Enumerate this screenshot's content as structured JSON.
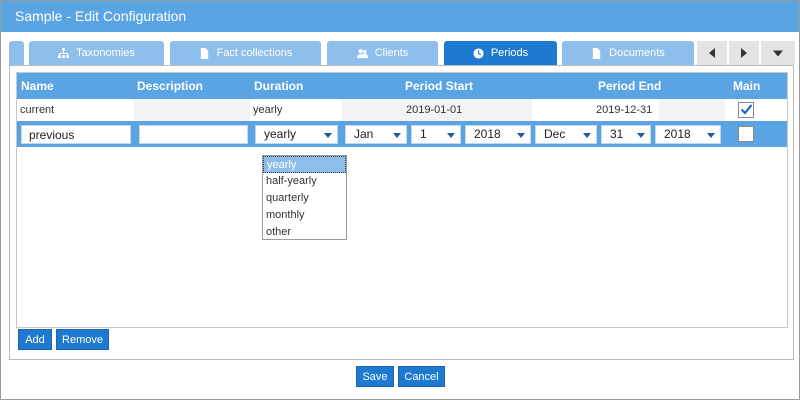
{
  "window": {
    "title": "Sample - Edit Configuration"
  },
  "tabs": [
    {
      "label": "Taxonomies",
      "icon": "hierarchy-icon",
      "active": false
    },
    {
      "label": "Fact collections",
      "icon": "document-icon",
      "active": false
    },
    {
      "label": "Clients",
      "icon": "users-icon",
      "active": false
    },
    {
      "label": "Periods",
      "icon": "clock-icon",
      "active": true
    },
    {
      "label": "Documents",
      "icon": "document-icon",
      "active": false
    }
  ],
  "grid": {
    "columns": {
      "name": "Name",
      "description": "Description",
      "duration": "Duration",
      "period_start": "Period Start",
      "period_end": "Period End",
      "main": "Main"
    },
    "rows": [
      {
        "name": "current",
        "description": "",
        "duration": "yearly",
        "period_start": "2019-01-01",
        "period_end": "2019-12-31",
        "main": true
      }
    ],
    "edit_row": {
      "name": "previous",
      "description": "",
      "duration": "yearly",
      "start_month": "Jan",
      "start_day": "1",
      "start_year": "2018",
      "end_month": "Dec",
      "end_day": "31",
      "end_year": "2018",
      "main": false
    }
  },
  "duration_options": [
    "yearly",
    "half-yearly",
    "quarterly",
    "monthly",
    "other"
  ],
  "duration_selected": "yearly",
  "panel_buttons": {
    "add": "Add",
    "remove": "Remove"
  },
  "footer_buttons": {
    "save": "Save",
    "cancel": "Cancel"
  },
  "colors": {
    "accent": "#5aa4e4",
    "active_tab": "#1e7ad0",
    "inactive_tab": "#8ebfec",
    "button": "#1e7ad0"
  }
}
